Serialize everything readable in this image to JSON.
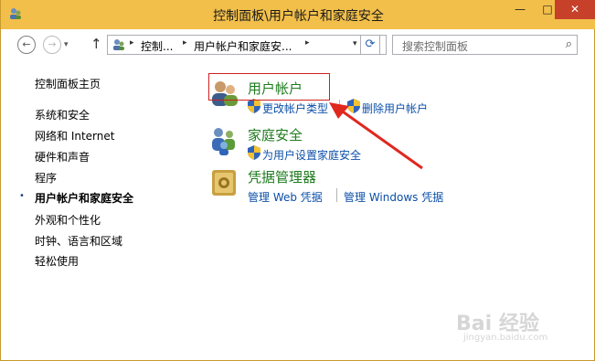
{
  "window": {
    "title": "控制面板\\用户帐户和家庭安全",
    "min_label": "—",
    "max_label": "□",
    "close_label": "✕"
  },
  "toolbar": {
    "back_label": "←",
    "forward_label": "→",
    "recent_label": "▾",
    "up_label": "↑",
    "refresh_label": "⟳"
  },
  "address": {
    "segments": [
      "控制...",
      "用户帐户和家庭安...",
      ""
    ],
    "chevron": "▸",
    "dropdown": "▾"
  },
  "search": {
    "placeholder": "搜索控制面板",
    "icon": "⌕"
  },
  "sidebar": {
    "bullet": "•",
    "items": [
      {
        "label": "控制面板主页"
      },
      {
        "label": "系统和安全"
      },
      {
        "label": "网络和 Internet"
      },
      {
        "label": "硬件和声音"
      },
      {
        "label": "程序"
      },
      {
        "label": "用户帐户和家庭安全",
        "active": true
      },
      {
        "label": "外观和个性化"
      },
      {
        "label": "时钟、语言和区域"
      },
      {
        "label": "轻松使用"
      }
    ]
  },
  "categories": [
    {
      "title": "用户帐户",
      "icon": "users-icon",
      "links": [
        "更改帐户类型",
        "删除用户帐户"
      ]
    },
    {
      "title": "家庭安全",
      "icon": "family-safety-icon",
      "links": [
        "为用户设置家庭安全"
      ]
    },
    {
      "title": "凭据管理器",
      "icon": "credential-vault-icon",
      "links": [
        "管理 Web 凭据",
        "管理 Windows 凭据"
      ]
    }
  ],
  "watermark": {
    "logo": "Bai 经验",
    "url": "jingyan.baidu.com"
  },
  "colors": {
    "titlebar": "#f2bf4a",
    "category_title": "#1e7b1e",
    "link": "#0c4fa8",
    "annotation": "#d02020",
    "close_button": "#c7402a"
  }
}
